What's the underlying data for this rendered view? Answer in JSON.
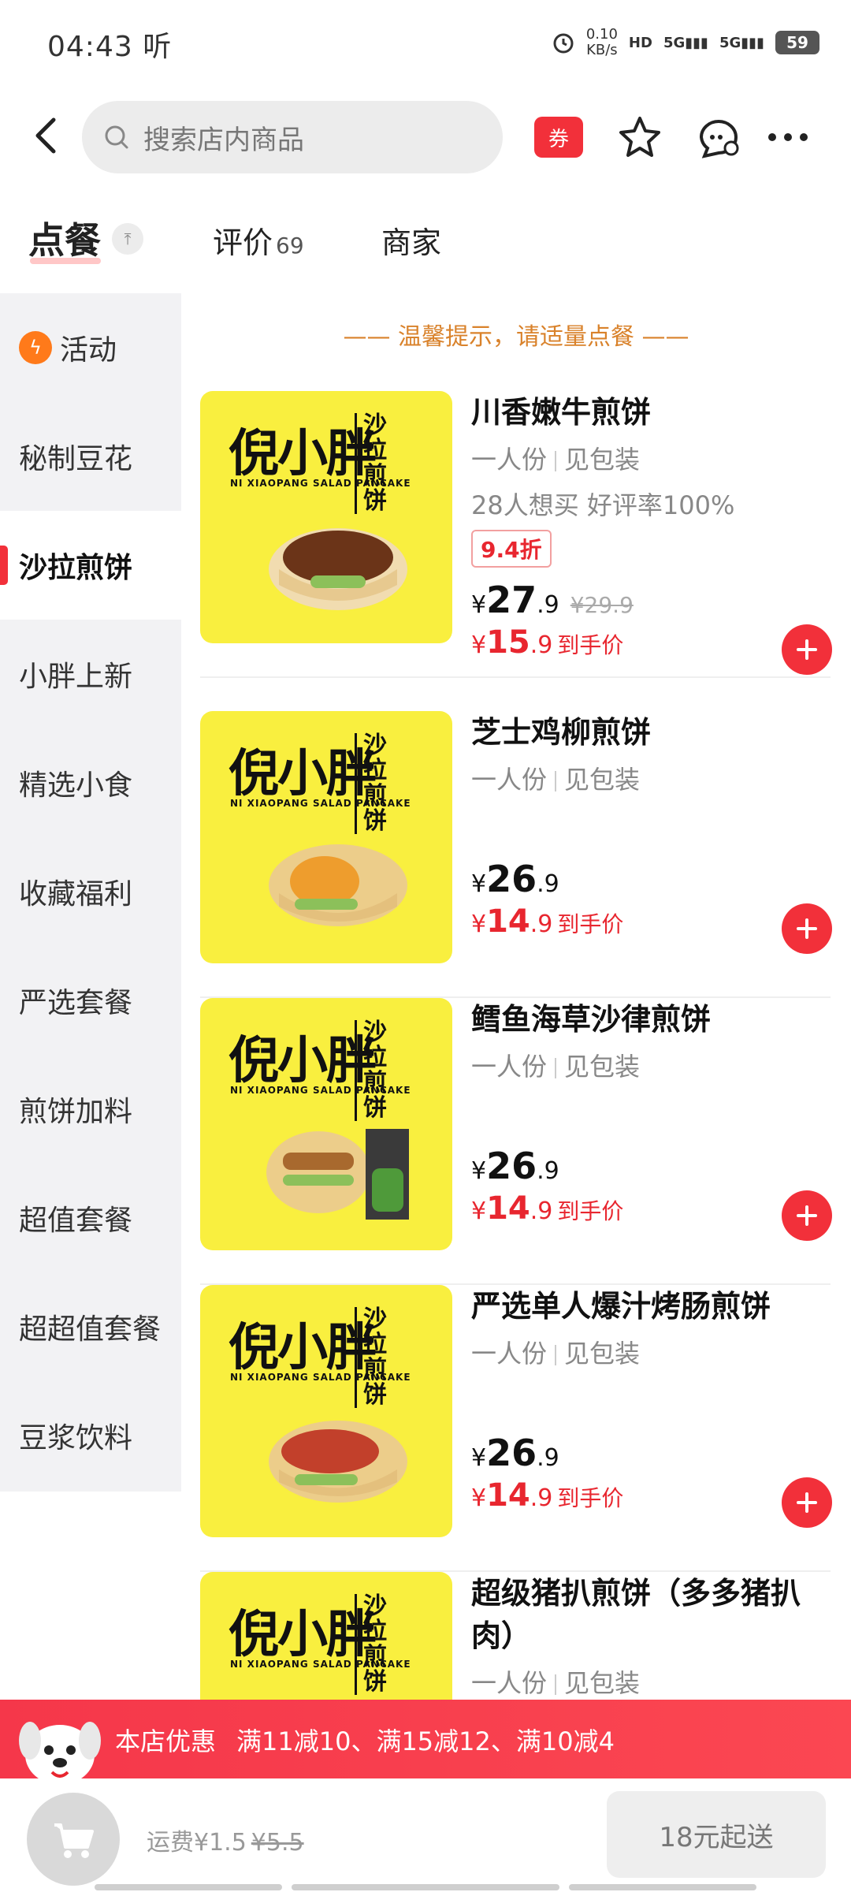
{
  "status_bar": {
    "time": "04:43",
    "carrier_glyph": "听",
    "net_speed_value": "0.10",
    "net_speed_unit": "KB/s",
    "hd_label": "HD",
    "sim1_label": "5G",
    "sim2_label": "5G",
    "battery": "59"
  },
  "header": {
    "search_placeholder": "搜索店内商品",
    "coupon_label": "券"
  },
  "tabs": {
    "order": "点餐",
    "reviews": "评价",
    "reviews_count": "69",
    "merchant": "商家"
  },
  "sidebar": {
    "items": [
      {
        "label": "活动"
      },
      {
        "label": "秘制豆花"
      },
      {
        "label": "沙拉煎饼"
      },
      {
        "label": "小胖上新"
      },
      {
        "label": "精选小食"
      },
      {
        "label": "收藏福利"
      },
      {
        "label": "严选套餐"
      },
      {
        "label": "煎饼加料"
      },
      {
        "label": "超值套餐"
      },
      {
        "label": "超超值套餐"
      },
      {
        "label": "豆浆饮料"
      }
    ]
  },
  "tip": "—— 温馨提示，请适量点餐 ——",
  "brand": {
    "name": "倪小胖",
    "side_text": "沙拉煎饼",
    "sub": "NI XIAOPANG   SALAD PANCAKE"
  },
  "products": [
    {
      "name": "川香嫩牛煎饼",
      "spec": "一人份",
      "pack": "见包装",
      "stats": "28人想买 好评率100%",
      "discount": "9.4折",
      "price_int": "27",
      "price_dec": ".9",
      "orig_price": "¥29.9",
      "deal_int": "15",
      "deal_dec": ".9",
      "deal_label": "到手价"
    },
    {
      "name": "芝士鸡柳煎饼",
      "spec": "一人份",
      "pack": "见包装",
      "price_int": "26",
      "price_dec": ".9",
      "deal_int": "14",
      "deal_dec": ".9",
      "deal_label": "到手价"
    },
    {
      "name": "鳕鱼海草沙律煎饼",
      "spec": "一人份",
      "pack": "见包装",
      "price_int": "26",
      "price_dec": ".9",
      "deal_int": "14",
      "deal_dec": ".9",
      "deal_label": "到手价"
    },
    {
      "name": "严选单人爆汁烤肠煎饼",
      "spec": "一人份",
      "pack": "见包装",
      "price_int": "26",
      "price_dec": ".9",
      "deal_int": "14",
      "deal_dec": ".9",
      "deal_label": "到手价"
    },
    {
      "name": "超级猪扒煎饼（多多猪扒肉）",
      "spec": "一人份",
      "pack": "见包装"
    }
  ],
  "currency": "¥",
  "promo": {
    "title": "本店优惠",
    "text": "满11减10、满15减12、满10减4"
  },
  "cart": {
    "fee_label": "运费¥1.5",
    "fee_orig": "¥5.5",
    "min_order": "18元起送"
  },
  "colors": {
    "accent": "#f2303a",
    "tip": "#d9822b",
    "image_bg": "#f9ef3f"
  }
}
